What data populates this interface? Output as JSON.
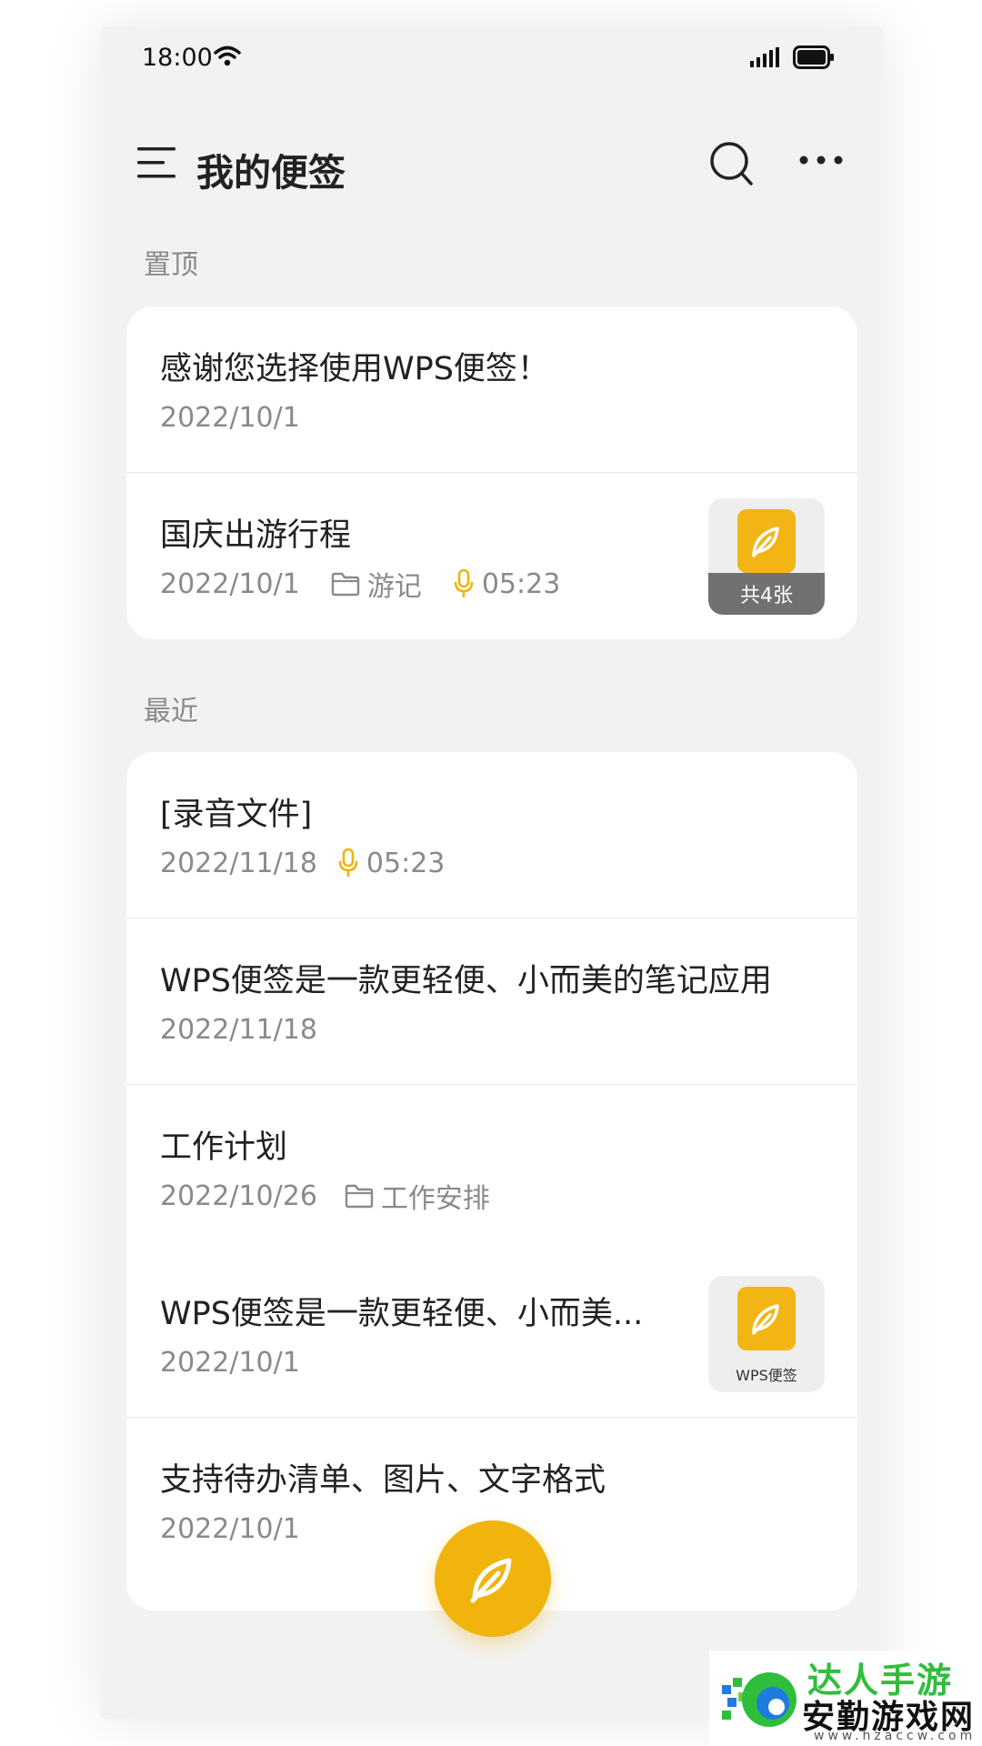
{
  "status_bar": {
    "time": "18:00"
  },
  "header": {
    "title": "我的便签",
    "menu_icon": "hamburger-menu-icon",
    "search_icon": "search-icon",
    "more_icon": "more-dots-icon"
  },
  "sections": {
    "pinned_label": "置顶",
    "recent_label": "最近"
  },
  "pinned_notes": [
    {
      "title": "感谢您选择使用WPS便签！",
      "date": "2022/10/1"
    },
    {
      "title": "国庆出游行程",
      "date": "2022/10/1",
      "folder": "游记",
      "audio_duration": "05:23",
      "thumb_caption": "共4张"
    }
  ],
  "recent_notes": [
    {
      "title": "[录音文件]",
      "date": "2022/11/18",
      "audio_duration": "05:23"
    },
    {
      "title": "WPS便签是一款更轻便、小而美的笔记应用",
      "date": "2022/11/18"
    },
    {
      "title": "工作计划",
      "date": "2022/10/26",
      "folder": "工作安排"
    },
    {
      "title": "WPS便签是一款更轻便、小而美...",
      "date": "2022/10/1",
      "thumb_caption": "WPS便签"
    },
    {
      "title": "支持待办清单、图片、文字格式",
      "date": "2022/10/1"
    }
  ],
  "fab": {
    "icon": "feather-leaf-icon"
  },
  "watermark": {
    "top": "达人手游",
    "main": "安勤游戏网",
    "url": "www.hzaccw.com"
  },
  "colors": {
    "accent": "#f0b40d",
    "background": "#f2f2f2",
    "card": "#ffffff",
    "meta_text": "#8a8a8a"
  }
}
